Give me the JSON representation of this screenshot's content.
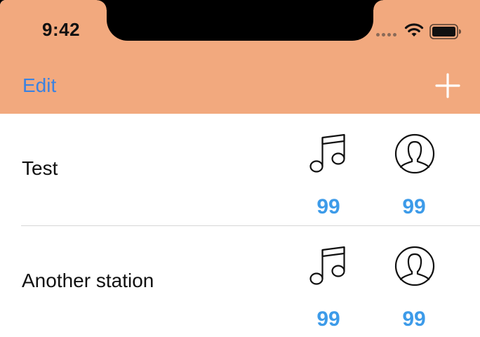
{
  "status_bar": {
    "time": "9:42"
  },
  "nav": {
    "edit_label": "Edit",
    "add_icon": "plus-icon",
    "tint_color": "#3b82e0",
    "bar_color": "#f2a97e"
  },
  "stations": [
    {
      "name": "Test",
      "songs": "99",
      "listeners": "99"
    },
    {
      "name": "Another station",
      "songs": "99",
      "listeners": "99"
    }
  ],
  "colors": {
    "count": "#3d9be9"
  }
}
